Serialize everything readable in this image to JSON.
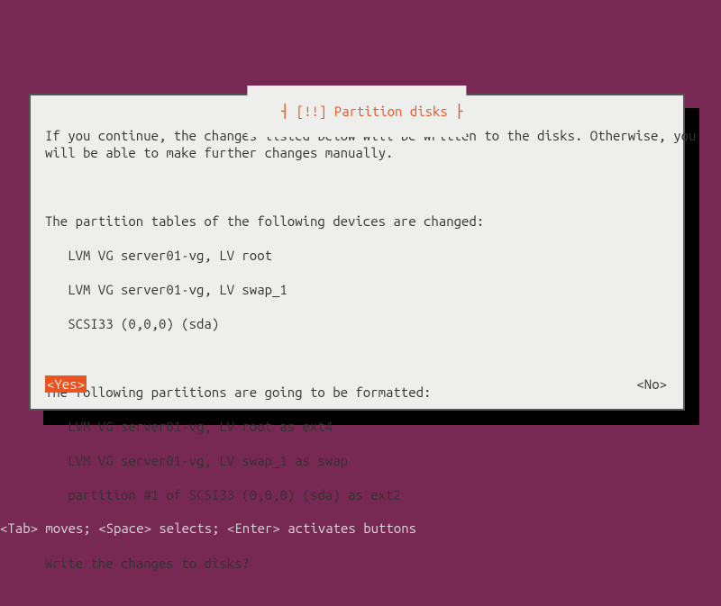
{
  "dialog": {
    "title": "[!!] Partition disks",
    "intro": "If you continue, the changes listed below will be written to the disks. Otherwise, you\nwill be able to make further changes manually.",
    "tables_header": "The partition tables of the following devices are changed:",
    "tables_items": [
      "LVM VG server01-vg, LV root",
      "LVM VG server01-vg, LV swap_1",
      "SCSI33 (0,0,0) (sda)"
    ],
    "format_header": "The following partitions are going to be formatted:",
    "format_items": [
      "LVM VG server01-vg, LV root as ext4",
      "LVM VG server01-vg, LV swap_1 as swap",
      "partition #1 of SCSI33 (0,0,0) (sda) as ext2"
    ],
    "prompt": "Write the changes to disks?",
    "yes": "<Yes>",
    "no": "<No>"
  },
  "footer": "<Tab> moves; <Space> selects; <Enter> activates buttons"
}
